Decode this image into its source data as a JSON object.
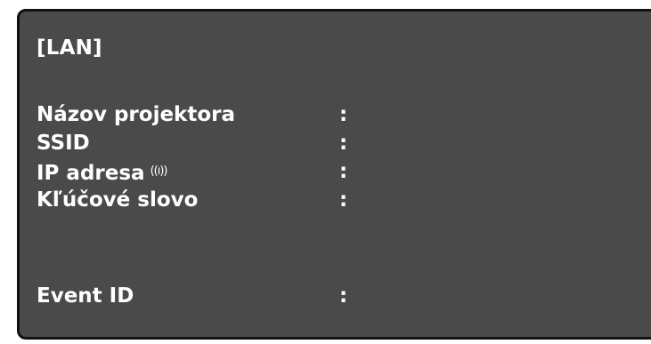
{
  "section_title": "[LAN]",
  "rows": [
    {
      "label": "Názov projektora",
      "separator": ":"
    },
    {
      "label": "SSID",
      "separator": ":"
    },
    {
      "label": "IP adresa",
      "separator": ":",
      "icon": "wireless-signal-icon",
      "icon_glyph": "((ı))"
    },
    {
      "label": "Kľúčové slovo",
      "separator": ":"
    },
    {
      "label": "Event ID",
      "separator": ":"
    }
  ],
  "colors": {
    "panel_background": "#4a4a4a",
    "panel_border": "#111111",
    "text": "#ffffff"
  }
}
